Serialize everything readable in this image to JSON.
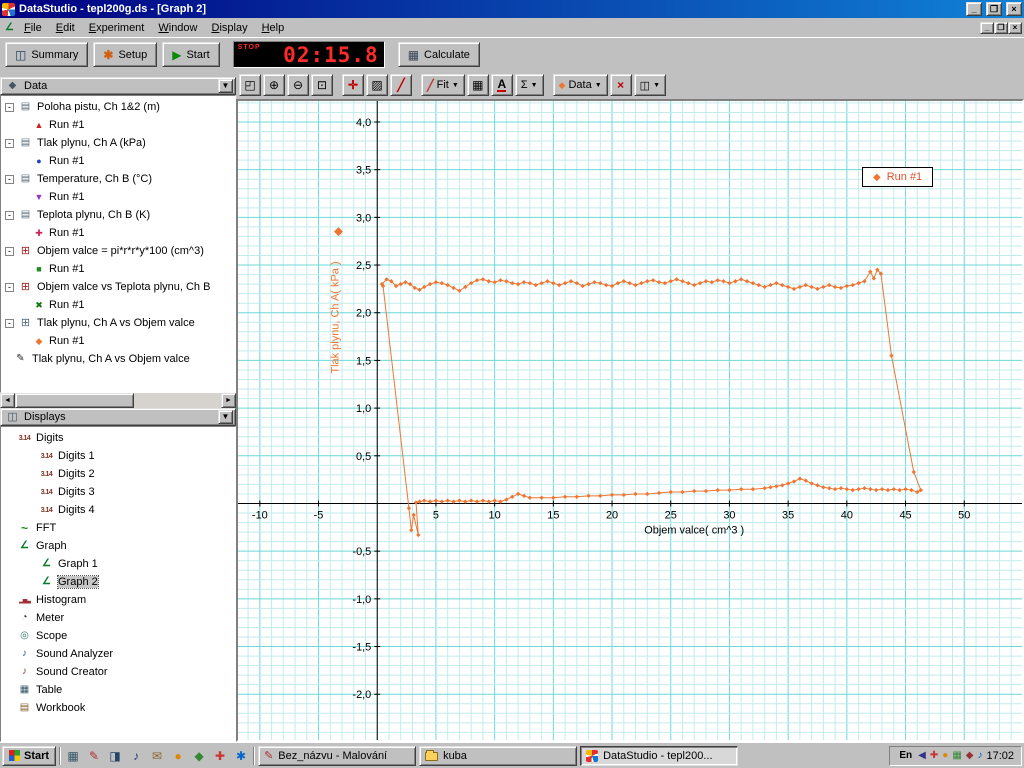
{
  "window": {
    "title": "DataStudio - tepl200g.ds - [Graph 2]",
    "menu": [
      "File",
      "Edit",
      "Experiment",
      "Window",
      "Display",
      "Help"
    ]
  },
  "toolbar": {
    "summary": "Summary",
    "setup": "Setup",
    "start": "Start",
    "calculate": "Calculate",
    "timer": {
      "status": "STOP",
      "value": "02:15.8"
    }
  },
  "graph_toolbar": {
    "fit": "Fit",
    "data": "Data",
    "text_tool": "A",
    "stats_tool": "Σ"
  },
  "sidebar": {
    "data": {
      "title": "Data",
      "items": [
        {
          "label": "Poloha pistu, Ch 1&2 (m)",
          "icon": "measurement-icon",
          "run": "Run #1",
          "marker": "triangle-up",
          "marker_color": "#cc2222"
        },
        {
          "label": "Tlak plynu, Ch A (kPa)",
          "icon": "measurement-icon",
          "run": "Run #1",
          "marker": "circle",
          "marker_color": "#2244cc"
        },
        {
          "label": "Temperature, Ch B (°C)",
          "icon": "measurement-icon",
          "run": "Run #1",
          "marker": "triangle-down",
          "marker_color": "#9933cc"
        },
        {
          "label": "Teplota plynu, Ch B (K)",
          "icon": "measurement-icon",
          "run": "Run #1",
          "marker": "plus",
          "marker_color": "#cc2255"
        },
        {
          "label": "Objem valce = pi*r*r*y*100 (cm^3)",
          "icon": "calculation-icon",
          "run": "Run #1",
          "marker": "square",
          "marker_color": "#228822"
        },
        {
          "label": "Objem valce vs Teplota plynu, Ch B",
          "icon": "calculation-icon",
          "run": "Run #1",
          "marker": "x",
          "marker_color": "#117711"
        },
        {
          "label": "Tlak plynu, Ch A vs Objem valce",
          "icon": "xy-data-icon",
          "run": "Run #1",
          "marker": "diamond",
          "marker_color": "#ee7633"
        },
        {
          "label": "Tlak plynu, Ch A vs Objem valce",
          "icon": "pen-data-icon"
        }
      ]
    },
    "displays": {
      "title": "Displays",
      "items": [
        {
          "label": "Digits",
          "icon": "digits-icon",
          "level": 0
        },
        {
          "label": "Digits 1",
          "icon": "digits-icon",
          "level": 1
        },
        {
          "label": "Digits 2",
          "icon": "digits-icon",
          "level": 1
        },
        {
          "label": "Digits 3",
          "icon": "digits-icon",
          "level": 1
        },
        {
          "label": "Digits 4",
          "icon": "digits-icon",
          "level": 1
        },
        {
          "label": "FFT",
          "icon": "fft-icon",
          "level": 0
        },
        {
          "label": "Graph",
          "icon": "graph-icon",
          "level": 0
        },
        {
          "label": "Graph 1",
          "icon": "graph-icon",
          "level": 1
        },
        {
          "label": "Graph 2",
          "icon": "graph-icon",
          "level": 1,
          "selected": true
        },
        {
          "label": "Histogram",
          "icon": "histogram-icon",
          "level": 0
        },
        {
          "label": "Meter",
          "icon": "meter-icon",
          "level": 0
        },
        {
          "label": "Scope",
          "icon": "scope-icon",
          "level": 0
        },
        {
          "label": "Sound Analyzer",
          "icon": "sound-icon",
          "level": 0
        },
        {
          "label": "Sound Creator",
          "icon": "sound-icon",
          "level": 0
        },
        {
          "label": "Table",
          "icon": "table-icon",
          "level": 0
        },
        {
          "label": "Workbook",
          "icon": "workbook-icon",
          "level": 0
        }
      ]
    }
  },
  "chart_data": {
    "type": "scatter",
    "title": "",
    "xlabel": "Objem valce( cm^3 )",
    "ylabel": "Tlak plynu, Ch A( kPa )",
    "series_name": "Run #1",
    "xlim": [
      -11.86,
      54.92
    ],
    "ylim": [
      -2.48,
      4.22
    ],
    "x_major": 5,
    "x_minor": 1,
    "y_major": 0.5,
    "y_minor": 0.1,
    "x_ticks": [
      {
        "v": -10,
        "label": "-10"
      },
      {
        "v": -5,
        "label": "-5"
      },
      {
        "v": 5,
        "label": "5"
      },
      {
        "v": 10,
        "label": "10"
      },
      {
        "v": 15,
        "label": "15"
      },
      {
        "v": 20,
        "label": "20"
      },
      {
        "v": 25,
        "label": "25"
      },
      {
        "v": 30,
        "label": "30"
      },
      {
        "v": 35,
        "label": "35"
      },
      {
        "v": 40,
        "label": "40"
      },
      {
        "v": 45,
        "label": "45"
      },
      {
        "v": 50,
        "label": "50"
      }
    ],
    "y_ticks": [
      {
        "v": 4.0,
        "label": "4,0"
      },
      {
        "v": 3.5,
        "label": "3,5"
      },
      {
        "v": 3.0,
        "label": "3,0"
      },
      {
        "v": 2.5,
        "label": "2,5"
      },
      {
        "v": 2.0,
        "label": "2,0"
      },
      {
        "v": 1.5,
        "label": "1,5"
      },
      {
        "v": 1.0,
        "label": "1,0"
      },
      {
        "v": 0.5,
        "label": "0,5"
      },
      {
        "v": -0.5,
        "label": "-0,5"
      },
      {
        "v": -1.0,
        "label": "-1,0"
      },
      {
        "v": -1.5,
        "label": "-1,5"
      },
      {
        "v": -2.0,
        "label": "-2,0"
      }
    ],
    "colors": {
      "series": "#ee7633",
      "grid_minor": "#c2ecec",
      "grid_major": "#6cd8d8",
      "axis": "#000000",
      "background": "#ffffff"
    },
    "points": [
      [
        0.4,
        2.3
      ],
      [
        0.8,
        2.35
      ],
      [
        1.2,
        2.33
      ],
      [
        1.6,
        2.28
      ],
      [
        2.0,
        2.3
      ],
      [
        2.4,
        2.32
      ],
      [
        2.8,
        2.3
      ],
      [
        3.2,
        2.26
      ],
      [
        3.6,
        2.24
      ],
      [
        4.0,
        2.27
      ],
      [
        4.5,
        2.3
      ],
      [
        5.0,
        2.32
      ],
      [
        5.5,
        2.31
      ],
      [
        6.0,
        2.29
      ],
      [
        6.5,
        2.26
      ],
      [
        7.0,
        2.23
      ],
      [
        7.5,
        2.27
      ],
      [
        8.0,
        2.31
      ],
      [
        8.5,
        2.34
      ],
      [
        9.0,
        2.35
      ],
      [
        9.5,
        2.33
      ],
      [
        10.0,
        2.32
      ],
      [
        10.5,
        2.34
      ],
      [
        11.0,
        2.33
      ],
      [
        11.5,
        2.31
      ],
      [
        12.0,
        2.3
      ],
      [
        12.5,
        2.32
      ],
      [
        13.0,
        2.31
      ],
      [
        13.5,
        2.29
      ],
      [
        14.0,
        2.31
      ],
      [
        14.5,
        2.33
      ],
      [
        15.0,
        2.31
      ],
      [
        15.5,
        2.29
      ],
      [
        16.0,
        2.31
      ],
      [
        16.5,
        2.33
      ],
      [
        17.0,
        2.31
      ],
      [
        17.5,
        2.28
      ],
      [
        18.0,
        2.3
      ],
      [
        18.5,
        2.32
      ],
      [
        19.0,
        2.31
      ],
      [
        19.5,
        2.29
      ],
      [
        20.0,
        2.28
      ],
      [
        20.5,
        2.31
      ],
      [
        21.0,
        2.33
      ],
      [
        21.5,
        2.31
      ],
      [
        22.0,
        2.29
      ],
      [
        22.5,
        2.31
      ],
      [
        23.0,
        2.33
      ],
      [
        23.5,
        2.34
      ],
      [
        24.0,
        2.32
      ],
      [
        24.5,
        2.31
      ],
      [
        25.0,
        2.33
      ],
      [
        25.5,
        2.35
      ],
      [
        26.0,
        2.33
      ],
      [
        26.5,
        2.31
      ],
      [
        27.0,
        2.29
      ],
      [
        27.5,
        2.31
      ],
      [
        28.0,
        2.33
      ],
      [
        28.5,
        2.32
      ],
      [
        29.0,
        2.34
      ],
      [
        29.5,
        2.33
      ],
      [
        30.0,
        2.31
      ],
      [
        30.5,
        2.33
      ],
      [
        31.0,
        2.35
      ],
      [
        31.5,
        2.33
      ],
      [
        32.0,
        2.31
      ],
      [
        32.5,
        2.29
      ],
      [
        33.0,
        2.27
      ],
      [
        33.5,
        2.29
      ],
      [
        34.0,
        2.31
      ],
      [
        34.5,
        2.29
      ],
      [
        35.0,
        2.27
      ],
      [
        35.5,
        2.25
      ],
      [
        36.0,
        2.27
      ],
      [
        36.5,
        2.29
      ],
      [
        37.0,
        2.27
      ],
      [
        37.5,
        2.25
      ],
      [
        38.0,
        2.27
      ],
      [
        38.5,
        2.29
      ],
      [
        39.0,
        2.27
      ],
      [
        39.5,
        2.26
      ],
      [
        40.0,
        2.28
      ],
      [
        40.5,
        2.29
      ],
      [
        41.0,
        2.31
      ],
      [
        41.5,
        2.33
      ],
      [
        42.0,
        2.43
      ],
      [
        42.3,
        2.36
      ],
      [
        42.6,
        2.45
      ],
      [
        42.9,
        2.41
      ],
      [
        43.8,
        1.55
      ],
      [
        45.7,
        0.33
      ],
      [
        46.3,
        0.14
      ],
      [
        46.0,
        0.12
      ],
      [
        45.5,
        0.14
      ],
      [
        45.0,
        0.15
      ],
      [
        44.5,
        0.14
      ],
      [
        44.0,
        0.15
      ],
      [
        43.5,
        0.14
      ],
      [
        43.0,
        0.15
      ],
      [
        42.5,
        0.14
      ],
      [
        42.0,
        0.15
      ],
      [
        41.5,
        0.16
      ],
      [
        41.0,
        0.15
      ],
      [
        40.5,
        0.14
      ],
      [
        40.0,
        0.15
      ],
      [
        39.5,
        0.16
      ],
      [
        39.0,
        0.15
      ],
      [
        38.5,
        0.16
      ],
      [
        38.0,
        0.17
      ],
      [
        37.5,
        0.19
      ],
      [
        37.0,
        0.21
      ],
      [
        36.5,
        0.24
      ],
      [
        36.0,
        0.26
      ],
      [
        35.5,
        0.23
      ],
      [
        35.0,
        0.21
      ],
      [
        34.5,
        0.19
      ],
      [
        34.0,
        0.18
      ],
      [
        33.5,
        0.17
      ],
      [
        33.0,
        0.16
      ],
      [
        32.0,
        0.15
      ],
      [
        31.0,
        0.15
      ],
      [
        30.0,
        0.14
      ],
      [
        29.0,
        0.14
      ],
      [
        28.0,
        0.13
      ],
      [
        27.0,
        0.13
      ],
      [
        26.0,
        0.12
      ],
      [
        25.0,
        0.12
      ],
      [
        24.0,
        0.11
      ],
      [
        23.0,
        0.1
      ],
      [
        22.0,
        0.1
      ],
      [
        21.0,
        0.09
      ],
      [
        20.0,
        0.09
      ],
      [
        19.0,
        0.08
      ],
      [
        18.0,
        0.08
      ],
      [
        17.0,
        0.07
      ],
      [
        16.0,
        0.07
      ],
      [
        15.0,
        0.06
      ],
      [
        14.0,
        0.06
      ],
      [
        13.0,
        0.06
      ],
      [
        12.5,
        0.08
      ],
      [
        12.0,
        0.1
      ],
      [
        11.5,
        0.07
      ],
      [
        11.0,
        0.04
      ],
      [
        10.5,
        0.02
      ],
      [
        10.0,
        0.03
      ],
      [
        9.5,
        0.02
      ],
      [
        9.0,
        0.03
      ],
      [
        8.5,
        0.02
      ],
      [
        8.0,
        0.03
      ],
      [
        7.5,
        0.02
      ],
      [
        7.0,
        0.03
      ],
      [
        6.5,
        0.02
      ],
      [
        6.0,
        0.03
      ],
      [
        5.5,
        0.02
      ],
      [
        5.0,
        0.03
      ],
      [
        4.5,
        0.02
      ],
      [
        4.0,
        0.03
      ],
      [
        3.6,
        0.02
      ],
      [
        3.3,
        0.01
      ],
      [
        3.5,
        -0.33
      ],
      [
        3.1,
        -0.12
      ],
      [
        2.9,
        -0.28
      ],
      [
        2.7,
        -0.05
      ],
      [
        0.5,
        2.28
      ]
    ]
  },
  "taskbar": {
    "start": "Start",
    "tasks": [
      {
        "label": "Bez_názvu - Malování",
        "icon": "paint-icon"
      },
      {
        "label": "kuba",
        "icon": "folder-icon"
      },
      {
        "label": "DataStudio - tepl200...",
        "icon": "datastudio-icon",
        "active": true
      }
    ],
    "tray": {
      "lang": "En",
      "time": "17:02"
    }
  }
}
